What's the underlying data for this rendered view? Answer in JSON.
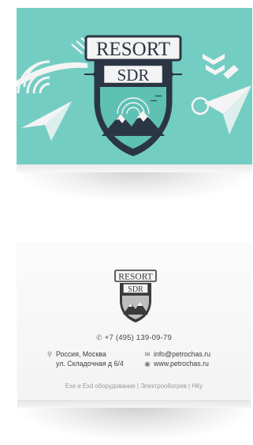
{
  "front_card": {
    "logo": {
      "word_top": "RESORT",
      "word_bottom": "SDR"
    },
    "colors": {
      "background": "#74cdc2",
      "badge_dark": "#2b3644",
      "badge_teal": "#5ec1b4",
      "ribbon": "#f4f4f4"
    }
  },
  "back_card": {
    "logo": {
      "word_top": "RESORT",
      "word_bottom": "SDR"
    },
    "phone_icon": "phone-icon",
    "phone": "+7 (495) 139-09-79",
    "address_icon": "location-pin-icon",
    "address_line1": "Россия, Москва",
    "address_line2": "ул. Складочная д 6/4",
    "email_icon": "envelope-icon",
    "email": "info@petrochas.ru",
    "web_icon": "globe-icon",
    "website": "www.petrochas.ru",
    "tagline": "Exe и Exd оборудование | Электрообогрев | НКу"
  }
}
